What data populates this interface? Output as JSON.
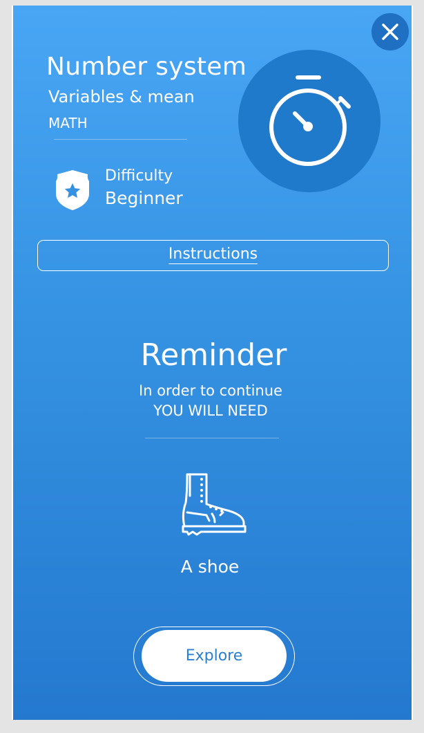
{
  "lesson": {
    "title": "Number system",
    "subtitle": "Variables & mean",
    "category": "MATH"
  },
  "difficulty": {
    "label": "Difficulty",
    "value": "Beginner"
  },
  "instructions": {
    "label": "Instructions"
  },
  "reminder": {
    "title": "Reminder",
    "line1": "In order to continue",
    "line2": "YOU WILL NEED",
    "item": "A shoe"
  },
  "actions": {
    "explore_label": "Explore"
  },
  "icons": {
    "close": "close-icon",
    "timer": "stopwatch-icon",
    "difficulty": "shield-star-icon",
    "item": "boot-icon"
  },
  "colors": {
    "background_top": "#48a6f5",
    "background_bottom": "#2479cf",
    "accent_dark": "#1f7acb",
    "button_text": "#2a7fd1"
  }
}
